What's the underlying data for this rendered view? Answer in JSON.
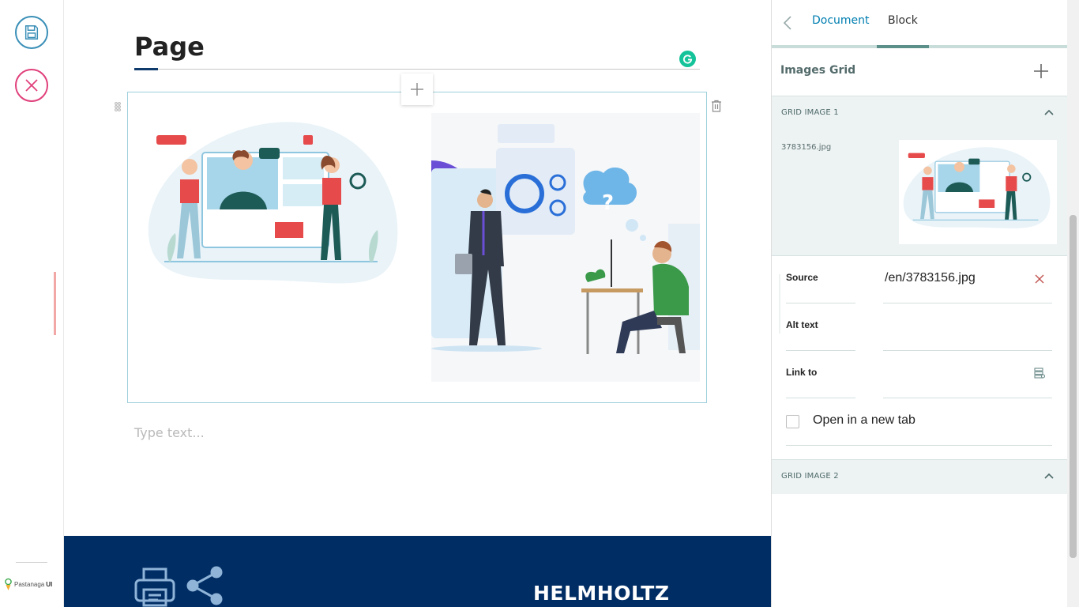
{
  "toolbar": {
    "save_icon": "save-icon",
    "cancel_icon": "close-icon",
    "brand_prefix": "Pastanaga",
    "brand_suffix": "UI"
  },
  "editor": {
    "title": "Page",
    "placeholder": "Type text...",
    "images": [
      {
        "file": "3783156.jpg",
        "kind": "illustration-video-call"
      },
      {
        "file": "illustration-business",
        "kind": "illustration-business"
      }
    ]
  },
  "footer": {
    "logo_text": "HELMHOLTZ",
    "background": "#002d64"
  },
  "sidebar": {
    "tabs": [
      {
        "label": "Document",
        "active": false
      },
      {
        "label": "Block",
        "active": true
      }
    ],
    "section_title": "Images Grid",
    "grid_items": [
      {
        "title": "GRID IMAGE 1",
        "expanded": true,
        "file_name": "3783156.jpg",
        "fields": {
          "source_label": "Source",
          "source_value": "/en/3783156.jpg",
          "alt_label": "Alt text",
          "alt_value": "",
          "link_label": "Link to",
          "link_value": "",
          "new_tab_label": "Open in a new tab",
          "new_tab_checked": false
        }
      },
      {
        "title": "GRID IMAGE 2",
        "expanded": false
      }
    ]
  },
  "colors": {
    "accent_blue": "#007eb1",
    "save_ring": "#3a8fb7",
    "cancel_ring": "#e0407b",
    "block_border": "#9fd0db",
    "panel_bg": "#edf2f2"
  }
}
